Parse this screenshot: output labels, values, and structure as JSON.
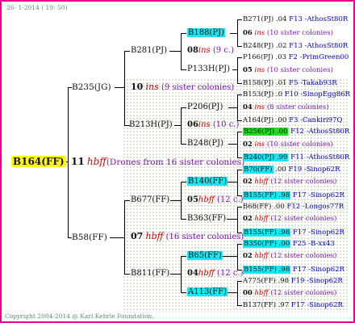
{
  "header": "26- 1-2014 ( 19: 50)",
  "footer": "Copyright 2004-2014 @ Karl Kehrle Foundation.",
  "root": {
    "id": "B164(FF)",
    "gen_num": "11",
    "gen_sym": "hbff",
    "note": "(Drones from 16 sister colonies)"
  },
  "gen1": [
    {
      "id": "B235(JG)",
      "gen_num": "10",
      "gen_sym": "ins",
      "note": "(9 sister colonies)"
    },
    {
      "id": "B58(FF)",
      "gen_num": "07",
      "gen_sym": "hbff",
      "note": "(16 sister colonies)"
    }
  ],
  "gen2": [
    {
      "id": "B281(PJ)",
      "gen_num": "08",
      "gen_sym": "ins",
      "note": "(9 c.)"
    },
    {
      "id": "B213H(PJ)",
      "gen_num": "06",
      "gen_sym": "ins",
      "note": "(10 c.)"
    },
    {
      "id": "B677(FF)",
      "gen_num": "05",
      "gen_sym": "hbff",
      "note": "(12 c.)"
    },
    {
      "id": "B811(FF)",
      "gen_num": "04",
      "gen_sym": "hbff",
      "note": "(12 c.)"
    }
  ],
  "gen3": [
    {
      "id": "B188(PJ)",
      "gen_num": "06",
      "gen_sym": "ins",
      "note": "(10 sister colonies)"
    },
    {
      "id": "P133H(PJ)",
      "gen_num": "05",
      "gen_sym": "ins",
      "note": "(10 sister colonies)"
    },
    {
      "id": "P206(PJ)",
      "gen_num": "04",
      "gen_sym": "ins",
      "note": "(8 sister colonies)"
    },
    {
      "id": "B248(PJ)",
      "gen_num": "02",
      "gen_sym": "ins",
      "note": "(10 sister colonies)"
    },
    {
      "id": "B140(FF)",
      "gen_num": "02",
      "gen_sym": "hbff",
      "note": "(12 sister colonies)"
    },
    {
      "id": "B363(FF)",
      "gen_num": "02",
      "gen_sym": "hbff",
      "note": "(12 sister colonies)"
    },
    {
      "id": "B65(FF)",
      "gen_num": "02",
      "gen_sym": "hbff",
      "note": "(12 sister colonies)"
    },
    {
      "id": "A113(FF)",
      "gen_num": "00",
      "gen_sym": "hbff",
      "note": "(12 sister colonies)"
    }
  ],
  "gen4": [
    {
      "id": "B271(PJ)",
      "code": ".04",
      "loc": "F13 -AthosSt80R"
    },
    {
      "id": "B248(PJ)",
      "code": ".02",
      "loc": "F13 -AthosSt80R"
    },
    {
      "id": "P166(PJ)",
      "code": ".03",
      "loc": "F2 -PrimGreen00"
    },
    {
      "id": "B158(PJ)",
      "code": ".01",
      "loc": "F5 -Takab93R"
    },
    {
      "id": "B153(PJ)",
      "code": ".0",
      "loc": "F10 -SinopEgg86R"
    },
    {
      "id": "A164(PJ)",
      "code": ".00",
      "loc": "F3 -Cankiri97Q"
    },
    {
      "id": "B256(PJ)",
      "code": ".00",
      "loc": "F12 -AthosSt80R"
    },
    {
      "id": "B240(PJ)",
      "code": ".99",
      "loc": "F11 -AthosSt80R"
    },
    {
      "id": "B70(FF)",
      "code": ".00",
      "loc": "F19 -Sinop62R"
    },
    {
      "id": "B155(FF)",
      "code": ".98",
      "loc": "F17 -Sinop62R"
    },
    {
      "id": "B68(FF)",
      "code": ".00",
      "loc": "F12 -Longos77R"
    },
    {
      "id": "B155(FF)",
      "code": ".98",
      "loc": "F17 -Sinop62R"
    },
    {
      "id": "B350(FF)",
      "code": ".00",
      "loc": "F25 -B-xx43"
    },
    {
      "id": "B155(FF)",
      "code": ".98",
      "loc": "F17 -Sinop62R"
    },
    {
      "id": "A775(FF)",
      "code": ".98",
      "loc": "F19 -Sinop62R"
    },
    {
      "id": "B137(FF)",
      "code": ".97",
      "loc": "F17 -Sinop62R"
    }
  ],
  "colors": {
    "border": "#e8008c",
    "root_highlight": "#ffff00",
    "cyan_highlight": "#19e6f0",
    "green_highlight": "#22dd22",
    "red_symbol": "#d00000",
    "purple_note": "#7a1aa6",
    "blue_link": "#0000b0"
  }
}
